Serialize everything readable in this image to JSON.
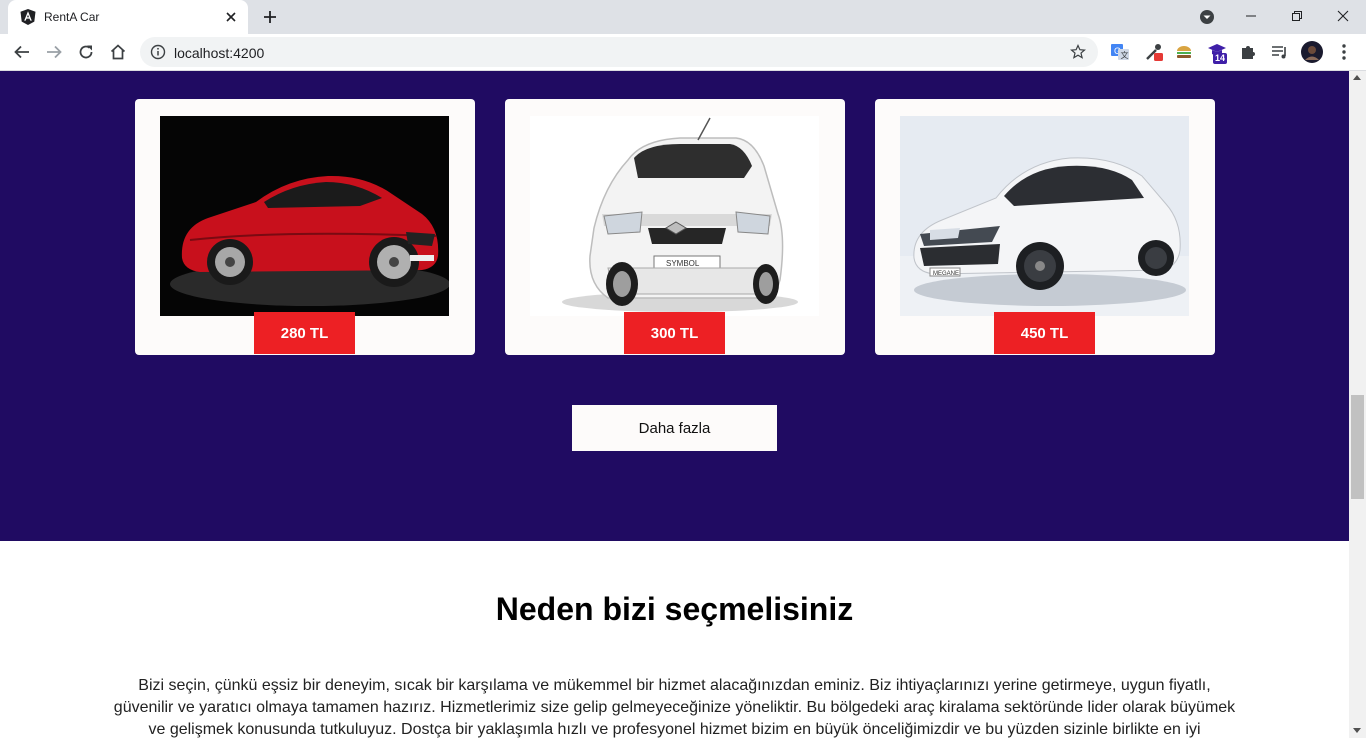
{
  "browser": {
    "tab_title": "RentA Car",
    "url": "localhost:4200",
    "ext_badge": "14"
  },
  "cars": [
    {
      "price": "280 TL",
      "color": "#d81f2a"
    },
    {
      "price": "300 TL",
      "color": "#f2f2f2"
    },
    {
      "price": "450 TL",
      "color": "#f2f2f2"
    }
  ],
  "more_button": "Daha fazla",
  "why": {
    "title": "Neden bizi seçmelisiniz",
    "text": "Bizi seçin, çünkü eşsiz bir deneyim, sıcak bir karşılama ve mükemmel bir hizmet alacağınızdan eminiz. Biz ihtiyaçlarınızı yerine getirmeye, uygun fiyatlı, güvenilir ve yaratıcı olmaya tamamen hazırız. Hizmetlerimiz size gelip gelmeyeceğinize yöneliktir. Bu bölgedeki araç kiralama sektöründe lider olarak büyümek ve gelişmek konusunda tutkuluyuz. Dostça bir yaklaşımla hızlı ve profesyonel hizmet bizim en büyük önceliğimizdir ve bu yüzden sizinle birlikte en iyi yaptığımız"
  },
  "colors": {
    "hero_bg": "#200b62",
    "price_bg": "#ed2024",
    "card_bg": "#fdfbfa"
  }
}
